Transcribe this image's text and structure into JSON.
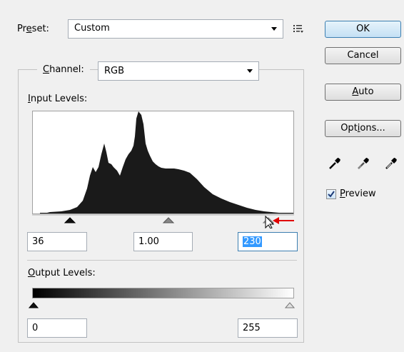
{
  "preset": {
    "label_pre": "Pr",
    "label_ul": "e",
    "label_post": "set:",
    "value": "Custom",
    "menu_icon": "list-menu-icon"
  },
  "buttons": {
    "ok": "OK",
    "cancel": "Cancel",
    "auto_ul": "A",
    "auto_rest": "uto",
    "options_pre": "Opt",
    "options_ul": "i",
    "options_post": "ons..."
  },
  "channel": {
    "label_ul": "C",
    "label_rest": "hannel:",
    "value": "RGB"
  },
  "input_levels": {
    "label_ul": "I",
    "label_rest": "nput Levels:",
    "shadow": "36",
    "midtone": "1.00",
    "highlight": "230"
  },
  "output_levels": {
    "label_ul": "O",
    "label_rest": "utput Levels:",
    "low": "0",
    "high": "255"
  },
  "preview": {
    "label_ul": "P",
    "label_rest": "review",
    "checked": true
  },
  "colors": {
    "annotation_arrow": "#e00000",
    "selection": "#3399ff",
    "histogram": "#1a1a1a"
  },
  "icons": {
    "eyedroppers": [
      "black-point-eyedropper-icon",
      "gray-point-eyedropper-icon",
      "white-point-eyedropper-icon"
    ]
  }
}
